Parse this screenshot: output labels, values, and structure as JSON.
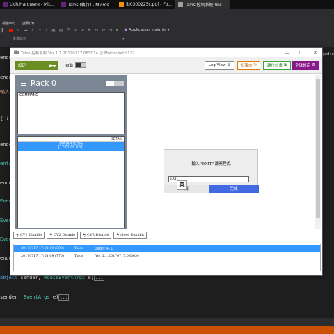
{
  "taskbar": {
    "tabs": [
      {
        "label": "Lich.Hardware - Mic...",
        "color": "#68217a"
      },
      {
        "label": "Talos (執行) - Micros...",
        "color": "#68217a"
      },
      {
        "label": "lb0300225c.pdf - Fo...",
        "color": "#f29111"
      },
      {
        "label": "Talos 控制系統 Ver....",
        "color": "#a0a0a0"
      }
    ]
  },
  "vs": {
    "menu": [
      "視窗(W)",
      "說明(H)"
    ],
    "app_insights": "Application Insights",
    "path_left": "",
    "path_mid": "未連結到",
    "right_text": "ged(o"
  },
  "code": {
    "lines": [
      {
        "text": "ender",
        "cls": ""
      },
      {
        "text": "ender",
        "cls": ""
      },
      {
        "text": "輸入",
        "cls": ""
      },
      {
        "text": "{ i",
        "cls": ""
      },
      {
        "text": "ender",
        "cls": ""
      },
      {
        "text": "entArgs",
        "cls": "ty"
      },
      {
        "text": "ender",
        "cls": ""
      },
      {
        "text": "Even",
        "cls": "ty"
      },
      {
        "text": "Even",
        "cls": "ty"
      },
      {
        "text": "Even",
        "cls": "ty"
      },
      {
        "text": "ender",
        "cls": ""
      }
    ],
    "line_object": {
      "kw": "object",
      "rest": " sender, ",
      "type": "MouseEventArgs",
      "tail": " e)"
    },
    "line_sender": {
      "rest": "sender, ",
      "type": "EventArgs",
      "tail": " e)"
    },
    "ellipsis": "..."
  },
  "talos": {
    "title": "Talos 控制系統 Ver 1.1.20170717.085034 @ MotionNet.L122",
    "toolbar": {
      "set_label": "設定",
      "auto_label": "自動",
      "logview_label": "Log View",
      "record_label": "記事本",
      "clear_label": "歸位計畫",
      "global_label": "全球設定"
    },
    "rack": {
      "title": "Rack 0",
      "command_label": "COMMAND",
      "detail_label": "DETAIL",
      "detail_item_line1": "請等候歸位完成",
      "detail_item_line2": "[17:01:09.828]"
    },
    "disable_buttons": [
      "CV1 Disable",
      "CV2 Disable",
      "CV3 Disable",
      "close Dashkit"
    ],
    "log": [
      {
        "time": "20170717 17:01:09 (390)",
        "source": "Talos",
        "message": "讀取元件: 1",
        "selected": true
      },
      {
        "time": "20170717 17:01:09 (770)",
        "source": "Talos",
        "message": "Ver 1.1.20170717.085034",
        "selected": false
      }
    ],
    "dialog": {
      "message": "輸入 \"EXIT\" 離開程式.",
      "input_value": "EXIT",
      "cancel_label": "消",
      "ok_label": "完成",
      "ime_label": "英"
    }
  }
}
